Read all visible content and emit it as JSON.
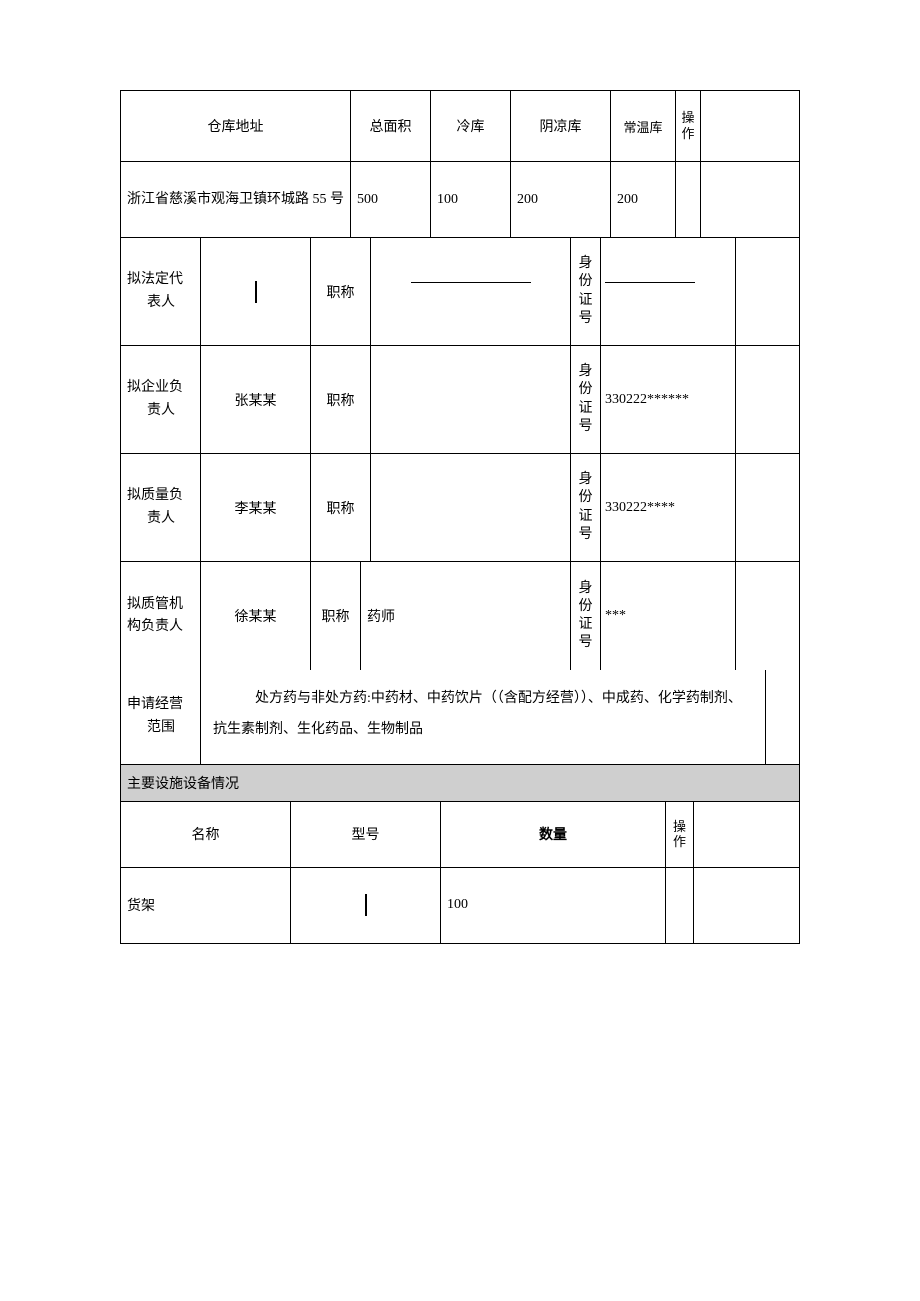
{
  "warehouse_hdr": {
    "addr": "仓库地址",
    "total": "总面积",
    "cold": "冷库",
    "cool": "阴凉库",
    "normal": "常温库",
    "op": "操作"
  },
  "warehouse_row": {
    "addr": "浙江省慈溪市观海卫镇环城路 55 号",
    "total": "500",
    "cold": "100",
    "cool": "200",
    "normal": "200",
    "op": ""
  },
  "people": [
    {
      "role_l1": "拟法定代",
      "role_l2": "表人",
      "name": "",
      "title_label": "职称",
      "title": "",
      "id_label": "身份证号",
      "id": "",
      "line_under": true
    },
    {
      "role_l1": "拟企业负",
      "role_l2": "责人",
      "name": "张某某",
      "title_label": "职称",
      "title": "",
      "id_label": "身份证号",
      "id": "330222******"
    },
    {
      "role_l1": "拟质量负",
      "role_l2": "责人",
      "name": "李某某",
      "title_label": "职称",
      "title": "",
      "id_label": "身份证号",
      "id": "330222****"
    },
    {
      "role_l1": "拟质管机",
      "role_l2": "构负责人",
      "name": "徐某某",
      "title_label": "职称",
      "title": "药师",
      "id_label": "身份证号",
      "id": "***"
    }
  ],
  "scope": {
    "label_l1": "申请经营",
    "label_l2": "范围",
    "text": "处方药与非处方药:中药材、中药饮片（（含配方经营））、中成药、化学药制剂、抗生素制剂、生化药品、生物制品"
  },
  "equip_section": "主要设施设备情况",
  "equip_hdr": {
    "name": "名称",
    "model": "型号",
    "qty": "数量",
    "op": "操作"
  },
  "equip_row": {
    "name": "货架",
    "model": "",
    "qty": "100",
    "op": ""
  }
}
